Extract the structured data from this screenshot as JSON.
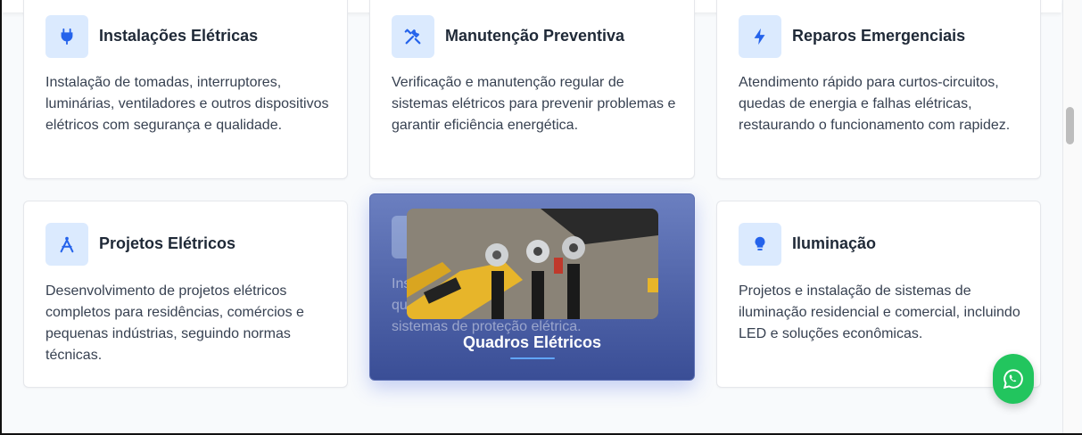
{
  "services": [
    {
      "title": "Instalações Elétricas",
      "description": "Instalação de tomadas, interruptores, luminárias, ventiladores e outros dispositivos elétricos com segurança e qualidade.",
      "icon": "plug-icon"
    },
    {
      "title": "Manutenção Preventiva",
      "description": "Verificação e manutenção regular de sistemas elétricos para prevenir problemas e garantir eficiência energética.",
      "icon": "tools-icon"
    },
    {
      "title": "Reparos Emergenciais",
      "description": "Atendimento rápido para curtos-circuitos, quedas de energia e falhas elétricas, restaurando o funcionamento com rapidez.",
      "icon": "bolt-icon"
    },
    {
      "title": "Projetos Elétricos",
      "description": "Desenvolvimento de projetos elétricos completos para residências, comércios e pequenas indústrias, seguindo normas técnicas.",
      "icon": "compass-icon"
    },
    {
      "title": "Quadros Elétricos",
      "partial_text_lines": [
        "Ins",
        "qu",
        "sistemas de proteção elétrica."
      ],
      "icon": "panel-icon",
      "photo_alt": "Battery cable lugs photo"
    },
    {
      "title": "Iluminação",
      "description": "Projetos e instalação de sistemas de iluminação residencial e comercial, incluindo LED e soluções econômicas.",
      "icon": "lightbulb-icon"
    }
  ],
  "floating": {
    "icon": "whatsapp-icon",
    "color": "#22c55e"
  },
  "colors": {
    "accent": "#2563eb",
    "icon_bg": "#dbeafe",
    "hover_bg": "#4f63a8"
  }
}
